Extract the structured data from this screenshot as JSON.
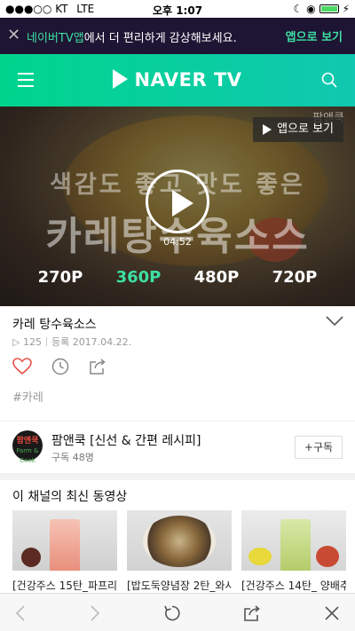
{
  "status_bar": {
    "carrier": "KT",
    "network": "LTE",
    "time": "오후 1:07"
  },
  "promo": {
    "highlight": "네이버TV앱",
    "message": "에서 더 편리하게 감상해보세요.",
    "cta": "앱으로 보기"
  },
  "header": {
    "logo_text": "NAVER TV"
  },
  "video": {
    "open_app_label": "앱으로 보기",
    "corner_tag": "팜앤쿡",
    "overlay_subtitle": "색감도 좋고 맛도 좋은",
    "overlay_title": "카레탕수육소스",
    "duration": "04:52",
    "qualities": [
      "270P",
      "360P",
      "480P",
      "720P"
    ],
    "selected_quality": "360P"
  },
  "info": {
    "title": "카레 탕수육소스",
    "play_count": "▷ 125",
    "registered": "등록 2017.04.22.",
    "tag": "#카레"
  },
  "channel": {
    "name": "팜앤쿡 [신선 & 간편 레시피]",
    "subscribers": "구독 48명",
    "subscribe_label": "구독",
    "avatar_line1": "팜앤쿡",
    "avatar_line2": "Farm & Cook"
  },
  "latest": {
    "heading": "이 채널의 최신 동영상",
    "items": [
      {
        "label": "[건강주스 15탄_파프리"
      },
      {
        "label": "[밥도둑양념장 2탄_와사"
      },
      {
        "label": "[건강주스 14탄_ 양배추"
      }
    ]
  },
  "colors": {
    "accent": "#3de0a3",
    "header_start": "#00d58d",
    "header_end": "#11c8b0",
    "promo_bg": "#1e1433",
    "like": "#e8524a"
  }
}
